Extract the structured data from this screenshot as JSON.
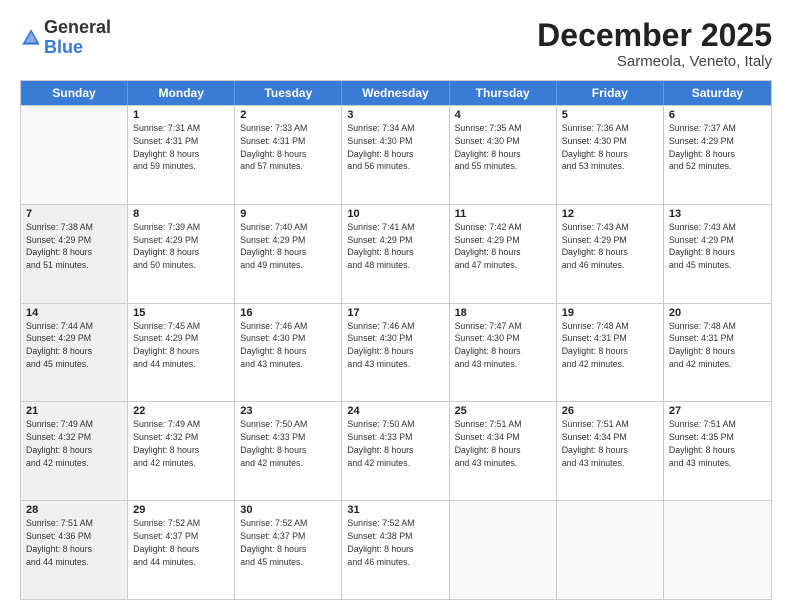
{
  "logo": {
    "general": "General",
    "blue": "Blue"
  },
  "header": {
    "month": "December 2025",
    "location": "Sarmeola, Veneto, Italy"
  },
  "days": [
    "Sunday",
    "Monday",
    "Tuesday",
    "Wednesday",
    "Thursday",
    "Friday",
    "Saturday"
  ],
  "rows": [
    [
      {
        "day": "",
        "info": "",
        "empty": true
      },
      {
        "day": "1",
        "info": "Sunrise: 7:31 AM\nSunset: 4:31 PM\nDaylight: 8 hours\nand 59 minutes."
      },
      {
        "day": "2",
        "info": "Sunrise: 7:33 AM\nSunset: 4:31 PM\nDaylight: 8 hours\nand 57 minutes."
      },
      {
        "day": "3",
        "info": "Sunrise: 7:34 AM\nSunset: 4:30 PM\nDaylight: 8 hours\nand 56 minutes."
      },
      {
        "day": "4",
        "info": "Sunrise: 7:35 AM\nSunset: 4:30 PM\nDaylight: 8 hours\nand 55 minutes."
      },
      {
        "day": "5",
        "info": "Sunrise: 7:36 AM\nSunset: 4:30 PM\nDaylight: 8 hours\nand 53 minutes."
      },
      {
        "day": "6",
        "info": "Sunrise: 7:37 AM\nSunset: 4:29 PM\nDaylight: 8 hours\nand 52 minutes."
      }
    ],
    [
      {
        "day": "7",
        "info": "Sunrise: 7:38 AM\nSunset: 4:29 PM\nDaylight: 8 hours\nand 51 minutes.",
        "shaded": true
      },
      {
        "day": "8",
        "info": "Sunrise: 7:39 AM\nSunset: 4:29 PM\nDaylight: 8 hours\nand 50 minutes."
      },
      {
        "day": "9",
        "info": "Sunrise: 7:40 AM\nSunset: 4:29 PM\nDaylight: 8 hours\nand 49 minutes."
      },
      {
        "day": "10",
        "info": "Sunrise: 7:41 AM\nSunset: 4:29 PM\nDaylight: 8 hours\nand 48 minutes."
      },
      {
        "day": "11",
        "info": "Sunrise: 7:42 AM\nSunset: 4:29 PM\nDaylight: 8 hours\nand 47 minutes."
      },
      {
        "day": "12",
        "info": "Sunrise: 7:43 AM\nSunset: 4:29 PM\nDaylight: 8 hours\nand 46 minutes."
      },
      {
        "day": "13",
        "info": "Sunrise: 7:43 AM\nSunset: 4:29 PM\nDaylight: 8 hours\nand 45 minutes."
      }
    ],
    [
      {
        "day": "14",
        "info": "Sunrise: 7:44 AM\nSunset: 4:29 PM\nDaylight: 8 hours\nand 45 minutes.",
        "shaded": true
      },
      {
        "day": "15",
        "info": "Sunrise: 7:45 AM\nSunset: 4:29 PM\nDaylight: 8 hours\nand 44 minutes."
      },
      {
        "day": "16",
        "info": "Sunrise: 7:46 AM\nSunset: 4:30 PM\nDaylight: 8 hours\nand 43 minutes."
      },
      {
        "day": "17",
        "info": "Sunrise: 7:46 AM\nSunset: 4:30 PM\nDaylight: 8 hours\nand 43 minutes."
      },
      {
        "day": "18",
        "info": "Sunrise: 7:47 AM\nSunset: 4:30 PM\nDaylight: 8 hours\nand 43 minutes."
      },
      {
        "day": "19",
        "info": "Sunrise: 7:48 AM\nSunset: 4:31 PM\nDaylight: 8 hours\nand 42 minutes."
      },
      {
        "day": "20",
        "info": "Sunrise: 7:48 AM\nSunset: 4:31 PM\nDaylight: 8 hours\nand 42 minutes."
      }
    ],
    [
      {
        "day": "21",
        "info": "Sunrise: 7:49 AM\nSunset: 4:32 PM\nDaylight: 8 hours\nand 42 minutes.",
        "shaded": true
      },
      {
        "day": "22",
        "info": "Sunrise: 7:49 AM\nSunset: 4:32 PM\nDaylight: 8 hours\nand 42 minutes."
      },
      {
        "day": "23",
        "info": "Sunrise: 7:50 AM\nSunset: 4:33 PM\nDaylight: 8 hours\nand 42 minutes."
      },
      {
        "day": "24",
        "info": "Sunrise: 7:50 AM\nSunset: 4:33 PM\nDaylight: 8 hours\nand 42 minutes."
      },
      {
        "day": "25",
        "info": "Sunrise: 7:51 AM\nSunset: 4:34 PM\nDaylight: 8 hours\nand 43 minutes."
      },
      {
        "day": "26",
        "info": "Sunrise: 7:51 AM\nSunset: 4:34 PM\nDaylight: 8 hours\nand 43 minutes."
      },
      {
        "day": "27",
        "info": "Sunrise: 7:51 AM\nSunset: 4:35 PM\nDaylight: 8 hours\nand 43 minutes."
      }
    ],
    [
      {
        "day": "28",
        "info": "Sunrise: 7:51 AM\nSunset: 4:36 PM\nDaylight: 8 hours\nand 44 minutes.",
        "shaded": true
      },
      {
        "day": "29",
        "info": "Sunrise: 7:52 AM\nSunset: 4:37 PM\nDaylight: 8 hours\nand 44 minutes."
      },
      {
        "day": "30",
        "info": "Sunrise: 7:52 AM\nSunset: 4:37 PM\nDaylight: 8 hours\nand 45 minutes."
      },
      {
        "day": "31",
        "info": "Sunrise: 7:52 AM\nSunset: 4:38 PM\nDaylight: 8 hours\nand 46 minutes."
      },
      {
        "day": "",
        "info": "",
        "empty": true
      },
      {
        "day": "",
        "info": "",
        "empty": true
      },
      {
        "day": "",
        "info": "",
        "empty": true
      }
    ]
  ]
}
